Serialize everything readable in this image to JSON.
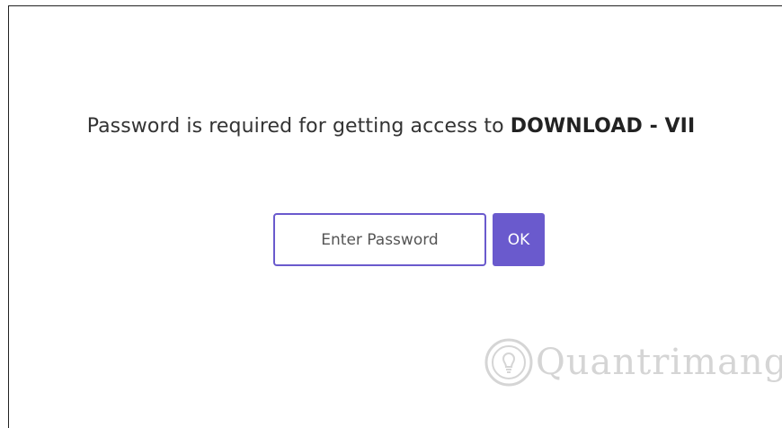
{
  "prompt": {
    "text": "Password is required for getting access to ",
    "target": "DOWNLOAD - VII"
  },
  "password": {
    "placeholder": "Enter Password",
    "value": ""
  },
  "ok_button": {
    "label": "OK"
  },
  "watermark": {
    "text": "Quantrimang",
    "icon": "lightbulb-icon"
  },
  "colors": {
    "accent": "#6a5acd",
    "text": "#333333",
    "border": "#222222"
  }
}
